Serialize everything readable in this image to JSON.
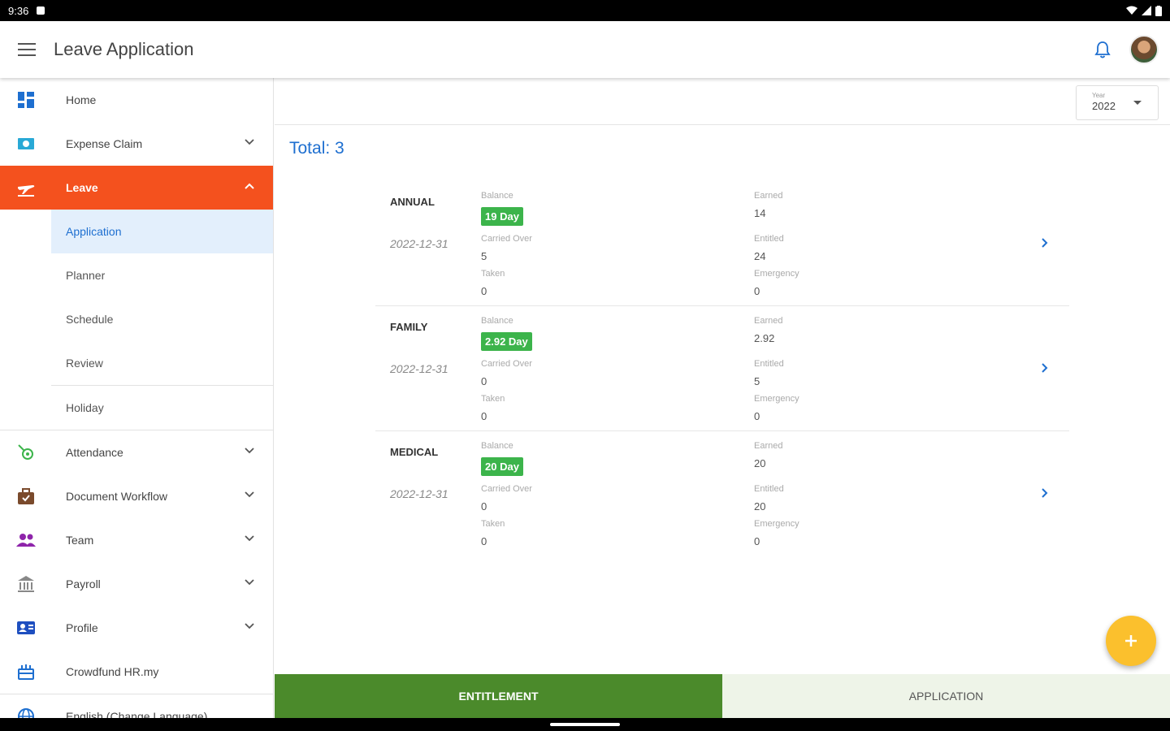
{
  "status_bar": {
    "time": "9:36"
  },
  "app_bar": {
    "title": "Leave Application"
  },
  "sidebar": {
    "home": "Home",
    "expense_claim": "Expense Claim",
    "leave": "Leave",
    "leave_sub": [
      "Application",
      "Planner",
      "Schedule",
      "Review",
      "Holiday"
    ],
    "attendance": "Attendance",
    "document_workflow": "Document Workflow",
    "team": "Team",
    "payroll": "Payroll",
    "profile": "Profile",
    "crowdfund": "Crowdfund HR.my",
    "language": "English (Change Language)"
  },
  "year_select": {
    "label": "Year",
    "value": "2022"
  },
  "total": "Total: 3",
  "field_labels": {
    "balance": "Balance",
    "carried_over": "Carried Over",
    "taken": "Taken",
    "earned": "Earned",
    "entitled": "Entitled",
    "emergency": "Emergency"
  },
  "leaves": [
    {
      "type": "ANNUAL",
      "date": "2022-12-31",
      "balance": "19 Day",
      "carried_over": "5",
      "taken": "0",
      "earned": "14",
      "entitled": "24",
      "emergency": "0"
    },
    {
      "type": "FAMILY",
      "date": "2022-12-31",
      "balance": "2.92 Day",
      "carried_over": "0",
      "taken": "0",
      "earned": "2.92",
      "entitled": "5",
      "emergency": "0"
    },
    {
      "type": "MEDICAL",
      "date": "2022-12-31",
      "balance": "20 Day",
      "carried_over": "0",
      "taken": "0",
      "earned": "20",
      "entitled": "20",
      "emergency": "0"
    }
  ],
  "tabs": {
    "entitlement": "ENTITLEMENT",
    "application": "APPLICATION"
  },
  "colors": {
    "accent_orange": "#f4511e",
    "link_blue": "#1e6fd0",
    "badge_green": "#3cb44b",
    "tab_green": "#4b8a2b",
    "fab_yellow": "#fbc02d"
  }
}
